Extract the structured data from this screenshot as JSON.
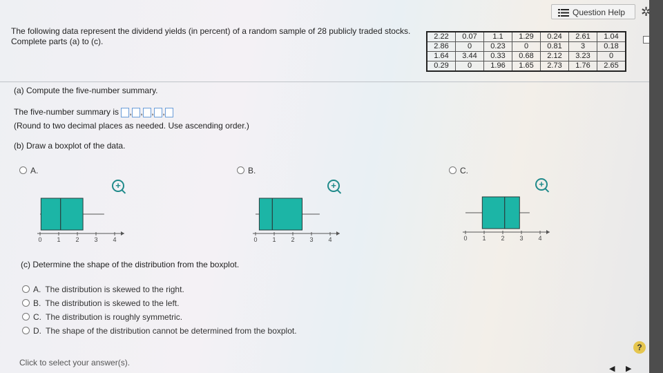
{
  "header": {
    "help_label": "Question Help"
  },
  "question": {
    "intro": "The following data represent the dividend yields (in percent) of a random sample of 28 publicly traded stocks. Complete parts (a) to (c)."
  },
  "data_table": {
    "rows": [
      [
        "2.22",
        "0.07",
        "1.1",
        "1.29",
        "0.24",
        "2.61",
        "1.04"
      ],
      [
        "2.86",
        "0",
        "0.23",
        "0",
        "0.81",
        "3",
        "0.18"
      ],
      [
        "1.64",
        "3.44",
        "0.33",
        "0.68",
        "2.12",
        "3.23",
        "0"
      ],
      [
        "0.29",
        "0",
        "1.96",
        "1.65",
        "2.73",
        "1.76",
        "2.65"
      ]
    ]
  },
  "part_a": {
    "heading": "(a) Compute the five-number summary.",
    "prompt": "The five-number summary is",
    "hint": "(Round to two decimal places as needed. Use ascending order.)",
    "inputs": [
      "",
      "",
      "",
      "",
      ""
    ]
  },
  "part_b": {
    "heading": "(b) Draw a boxplot of the data.",
    "options": [
      {
        "label": "A.",
        "min": 0,
        "q1": 0.05,
        "median": 1.1,
        "q3": 2.3,
        "max": 3.44
      },
      {
        "label": "B.",
        "min": 0,
        "q1": 0.2,
        "median": 0.9,
        "q3": 2.5,
        "max": 3.44
      },
      {
        "label": "C.",
        "min": 0,
        "q1": 0.9,
        "median": 2.1,
        "q3": 2.9,
        "max": 3.44
      }
    ],
    "axis_ticks": [
      "0",
      "1",
      "2",
      "3",
      "4"
    ]
  },
  "part_c": {
    "heading": "(c) Determine the shape of the distribution from the boxplot.",
    "options": [
      {
        "letter": "A.",
        "text": "The distribution is skewed to the right."
      },
      {
        "letter": "B.",
        "text": "The distribution is skewed to the left."
      },
      {
        "letter": "C.",
        "text": "The distribution is roughly symmetric."
      },
      {
        "letter": "D.",
        "text": "The shape of the distribution cannot be determined from the boxplot."
      }
    ]
  },
  "footer": {
    "instruction": "Click to select your answer(s).",
    "help_symbol": "?"
  },
  "colors": {
    "box_fill": "#1cb5a6",
    "box_stroke": "#2a3b3b",
    "input_border": "#6a9cd8",
    "zoom_icon": "#1f8a8a"
  }
}
